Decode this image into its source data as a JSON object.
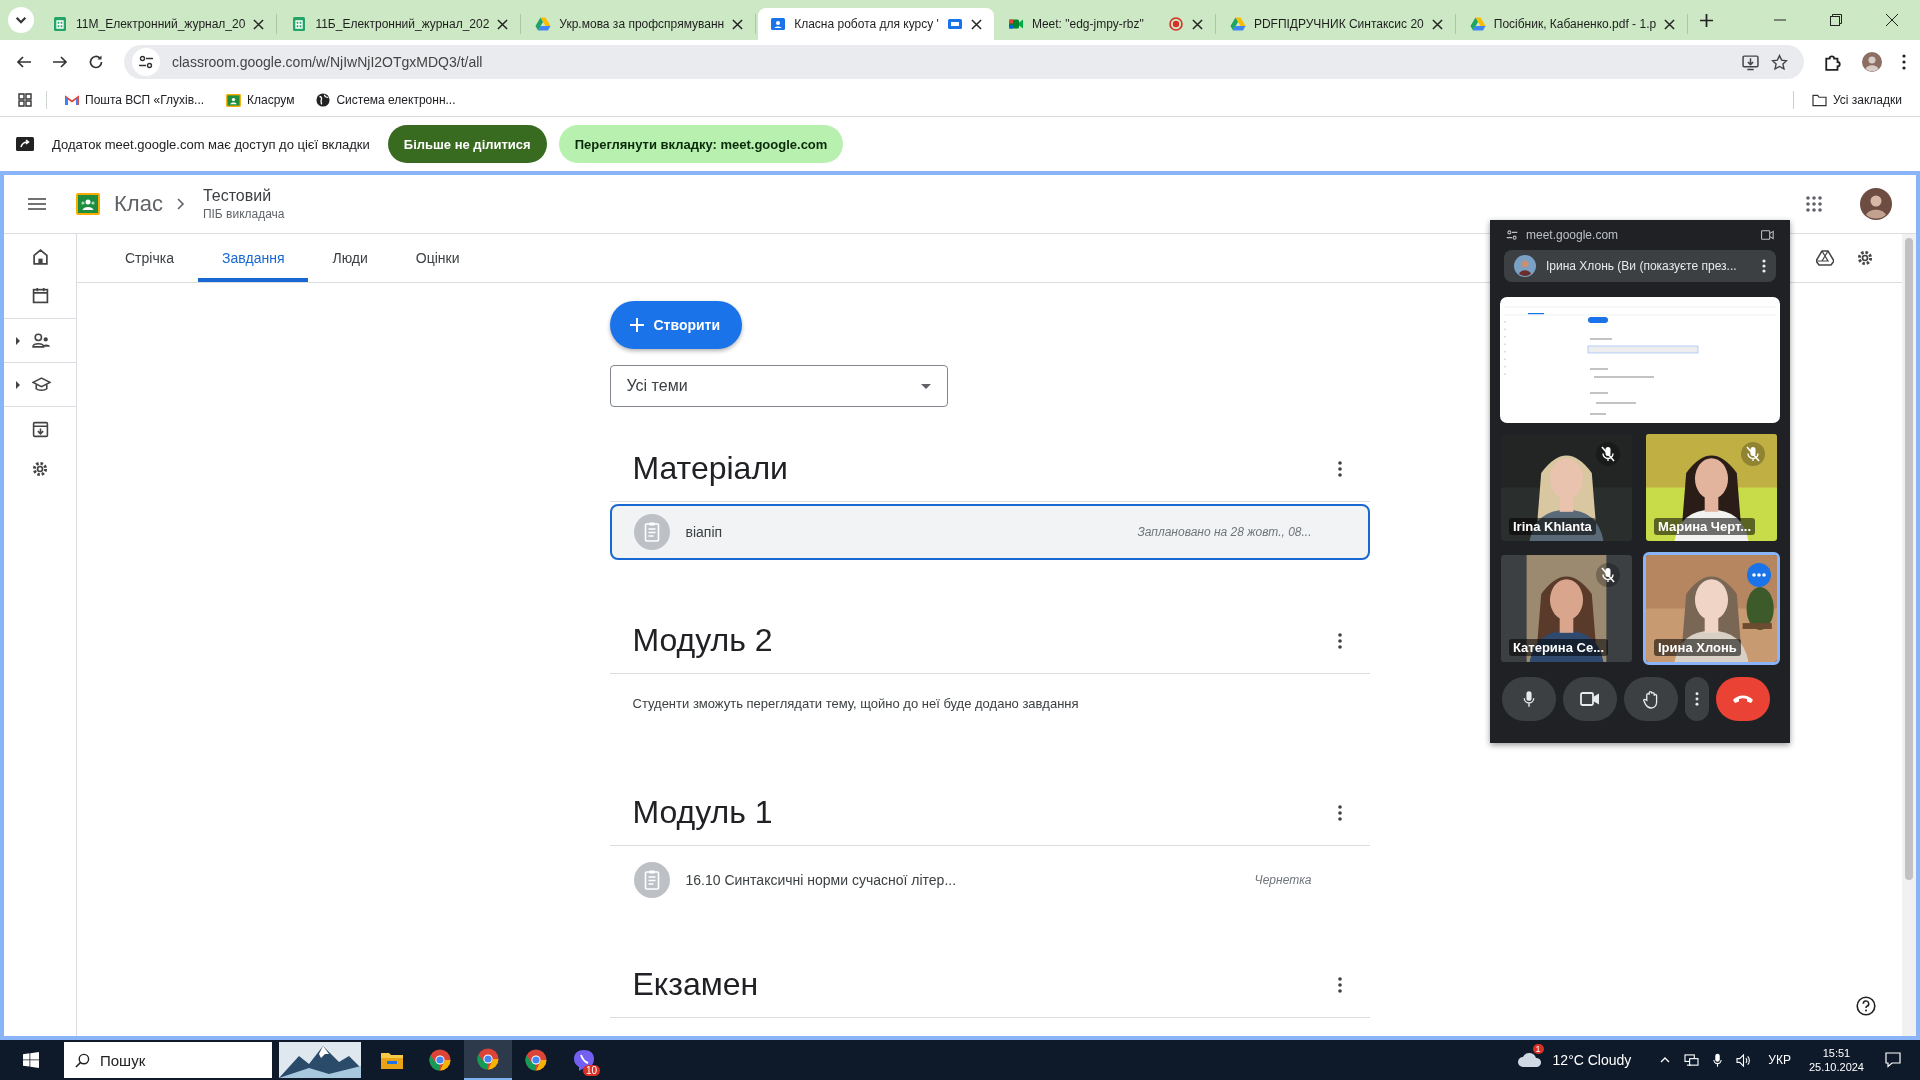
{
  "browser": {
    "tabs": [
      {
        "title": "11М_Електронний_журнал_20",
        "kind": "sheets",
        "selected": false,
        "sharing": false,
        "recording": false
      },
      {
        "title": "11Б_Електронний_журнал_202",
        "kind": "sheets",
        "selected": false,
        "sharing": false,
        "recording": false
      },
      {
        "title": "Укр.мова за профспрямуванн",
        "kind": "drive",
        "selected": false,
        "sharing": false,
        "recording": false
      },
      {
        "title": "Класна робота для курсу '",
        "kind": "classroom",
        "selected": true,
        "sharing": true,
        "recording": false
      },
      {
        "title": "Meet: \"edg-jmpy-rbz\"",
        "kind": "meet",
        "selected": false,
        "sharing": false,
        "recording": true
      },
      {
        "title": "PDFПІДРУЧНИК Синтаксис 20",
        "kind": "drive",
        "selected": false,
        "sharing": false,
        "recording": false
      },
      {
        "title": "Посібник, Кабаненко.pdf - 1.p",
        "kind": "drive",
        "selected": false,
        "sharing": false,
        "recording": false
      }
    ],
    "address": "classroom.google.com/w/NjIwNjI2OTgxMDQ3/t/all",
    "bookmarks": [
      {
        "label": "Пошта ВСП «Глухів...",
        "kind": "gmail"
      },
      {
        "label": "Класрум",
        "kind": "classroom"
      },
      {
        "label": "Система електронн...",
        "kind": "globe"
      }
    ],
    "all_bookmarks": "Усі закладки"
  },
  "share_bar": {
    "text": "Додаток meet.google.com має доступ до цієї вкладки",
    "stop_button": "Більше не ділитися",
    "view_button": "Переглянути вкладку: meet.google.com"
  },
  "classroom": {
    "app_name": "Клас",
    "class_name": "Тестовий",
    "teacher": "ПІБ викладача",
    "tabs": [
      {
        "label": "Стрічка",
        "selected": false
      },
      {
        "label": "Завдання",
        "selected": true
      },
      {
        "label": "Люди",
        "selected": false
      },
      {
        "label": "Оцінки",
        "selected": false
      }
    ],
    "create_button": "Створити",
    "topic_filter": "Усі теми",
    "topics": [
      {
        "title": "Матеріали",
        "items": [
          {
            "title": "віапіп",
            "status": "Заплановано на 28 жовт., 08...",
            "selected": true
          }
        ]
      },
      {
        "title": "Модуль 2",
        "note": "Студенти зможуть переглядати тему, щойно до неї буде додано завдання"
      },
      {
        "title": "Модуль 1",
        "items": [
          {
            "title": "16.10 Синтаксичні норми сучасної літер...",
            "status": "Чернетка",
            "selected": false
          }
        ]
      },
      {
        "title": "Екзамен"
      }
    ]
  },
  "meet": {
    "origin": "meet.google.com",
    "presenter": "Ірина Хлонь (Ви (показуєте през...",
    "tiles": [
      {
        "name": "Irina Khlanta",
        "muted": true,
        "selected": false
      },
      {
        "name": "Марина Черт...",
        "muted": true,
        "selected": false
      },
      {
        "name": "Катерина Се...",
        "muted": true,
        "selected": false
      },
      {
        "name": "Ірина Хлонь",
        "muted": false,
        "selected": true
      }
    ]
  },
  "taskbar": {
    "search_placeholder": "Пошук",
    "apps": [
      {
        "kind": "explorer",
        "active": false
      },
      {
        "kind": "chrome",
        "active": false
      },
      {
        "kind": "chrome",
        "active": true
      },
      {
        "kind": "chrome",
        "active": false
      },
      {
        "kind": "viber",
        "active": false,
        "badge": "10"
      }
    ],
    "weather": "12°C Cloudy",
    "weather_badge": "1",
    "language": "УКР",
    "time": "15:51",
    "date": "25.10.2024"
  }
}
